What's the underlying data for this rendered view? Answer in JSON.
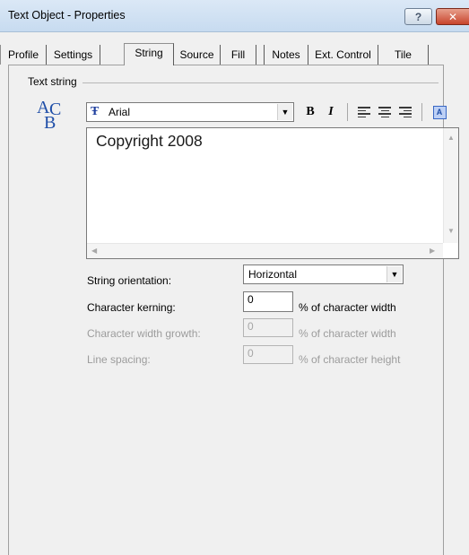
{
  "window": {
    "title": "Text Object - Properties",
    "help_label": "?",
    "close_label": "✕"
  },
  "tabs": [
    {
      "label": "Profile"
    },
    {
      "label": "Settings"
    },
    {
      "label": "String"
    },
    {
      "label": "Source"
    },
    {
      "label": "Fill"
    },
    {
      "label": "Notes"
    },
    {
      "label": "Ext. Control"
    },
    {
      "label": "Tile"
    }
  ],
  "active_tab": "String",
  "text_group": {
    "label": "Text string",
    "icon_letters": {
      "a": "A",
      "b": "B",
      "c": "C"
    }
  },
  "toolbar": {
    "font_name": "Arial",
    "font_icon": "Ŧ",
    "bold_label": "B",
    "italic_label": "I",
    "box_label": "A"
  },
  "text_value": "Copyright 2008",
  "fields": {
    "orientation": {
      "label": "String orientation:",
      "value": "Horizontal"
    },
    "kerning": {
      "label": "Character kerning:",
      "value": "0",
      "unit": "% of character width"
    },
    "width_growth": {
      "label": "Character width growth:",
      "value": "0",
      "unit": "% of character width"
    },
    "line_spacing": {
      "label": "Line spacing:",
      "value": "0",
      "unit": "% of character height"
    }
  },
  "colors": {
    "accent_blue": "#1f4ea8",
    "close_red": "#c7442c",
    "disabled_text": "#9c9c9c"
  }
}
